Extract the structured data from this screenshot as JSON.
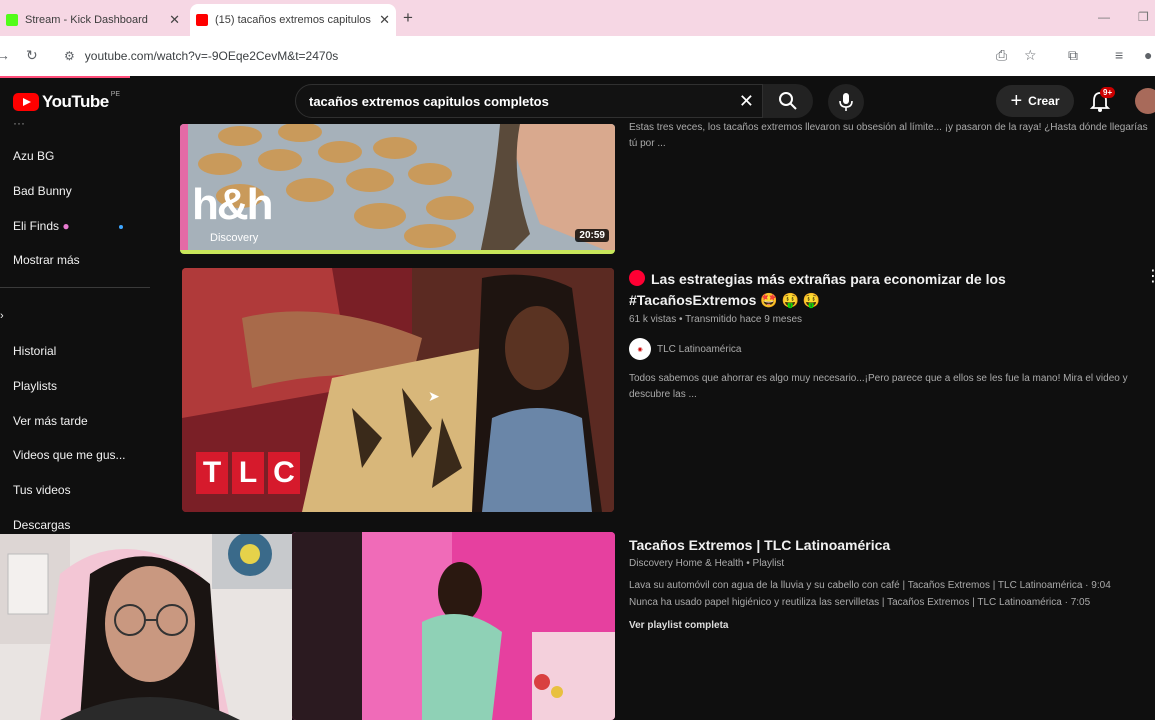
{
  "browser": {
    "tabs": [
      {
        "title": "Stream - Kick Dashboard",
        "favicon_color": "#53fc18"
      },
      {
        "title": "(15) tacaños extremos capitulos",
        "favicon_color": "#ff0000"
      }
    ],
    "url": "youtube.com/watch?v=-9OEqe2CevM&t=2470s"
  },
  "header": {
    "logo_text": "YouTube",
    "country_code": "PE",
    "search_query": "tacaños extremos capitulos completos",
    "create_label": "Crear",
    "notifications_badge": "9+"
  },
  "sidebar": {
    "subscriptions": [
      "Azu BG",
      "Bad Bunny",
      "Eli Finds",
      "Mostrar más"
    ],
    "you_section": [
      "Historial",
      "Playlists",
      "Ver más tarde",
      "Videos que me gus...",
      "Tus videos",
      "Descargas"
    ]
  },
  "results": [
    {
      "desc_top_line1": "Estas tres veces, los tacaños extremos llevaron su obsesión al límite... ¡y pasaron de la raya! ¿Hasta dónde llegarías",
      "desc_top_line2": "tú por ...",
      "duration": "20:59",
      "thumb_text": "h&h",
      "thumb_brand": "Discovery"
    },
    {
      "title_line1": "Las estrategias más extrañas para economizar de los",
      "title_line2": "#TacañosExtremos 🤩 🤑 🤑",
      "meta": "61 k vistas • Transmitido hace 9 meses",
      "channel": "TLC Latinoamérica",
      "description_line1": "Todos sabemos que ahorrar es algo muy necesario...¡Pero parece que a ellos se les fue la mano! Mira el video y",
      "description_line2": "descubre las ...",
      "thumb_logo": [
        "T",
        "L",
        "C"
      ]
    },
    {
      "title": "Tacaños Extremos | TLC Latinoamérica",
      "meta": "Discovery Home & Health • Playlist",
      "item1": "Lava su automóvil con agua de la lluvia y su cabello con café | Tacaños Extremos | TLC Latinoamérica · 9:04",
      "item2": "Nunca ha usado papel higiénico y reutiliza las servilletas | Tacaños Extremos | TLC Latinoamérica · 7:05",
      "view_all": "Ver playlist completa"
    }
  ],
  "colors": {
    "background": "#0f0f0f",
    "tab_strip": "#f6d7e4",
    "accent_red": "#ff0000",
    "link_blue": "#3ea6ff"
  }
}
